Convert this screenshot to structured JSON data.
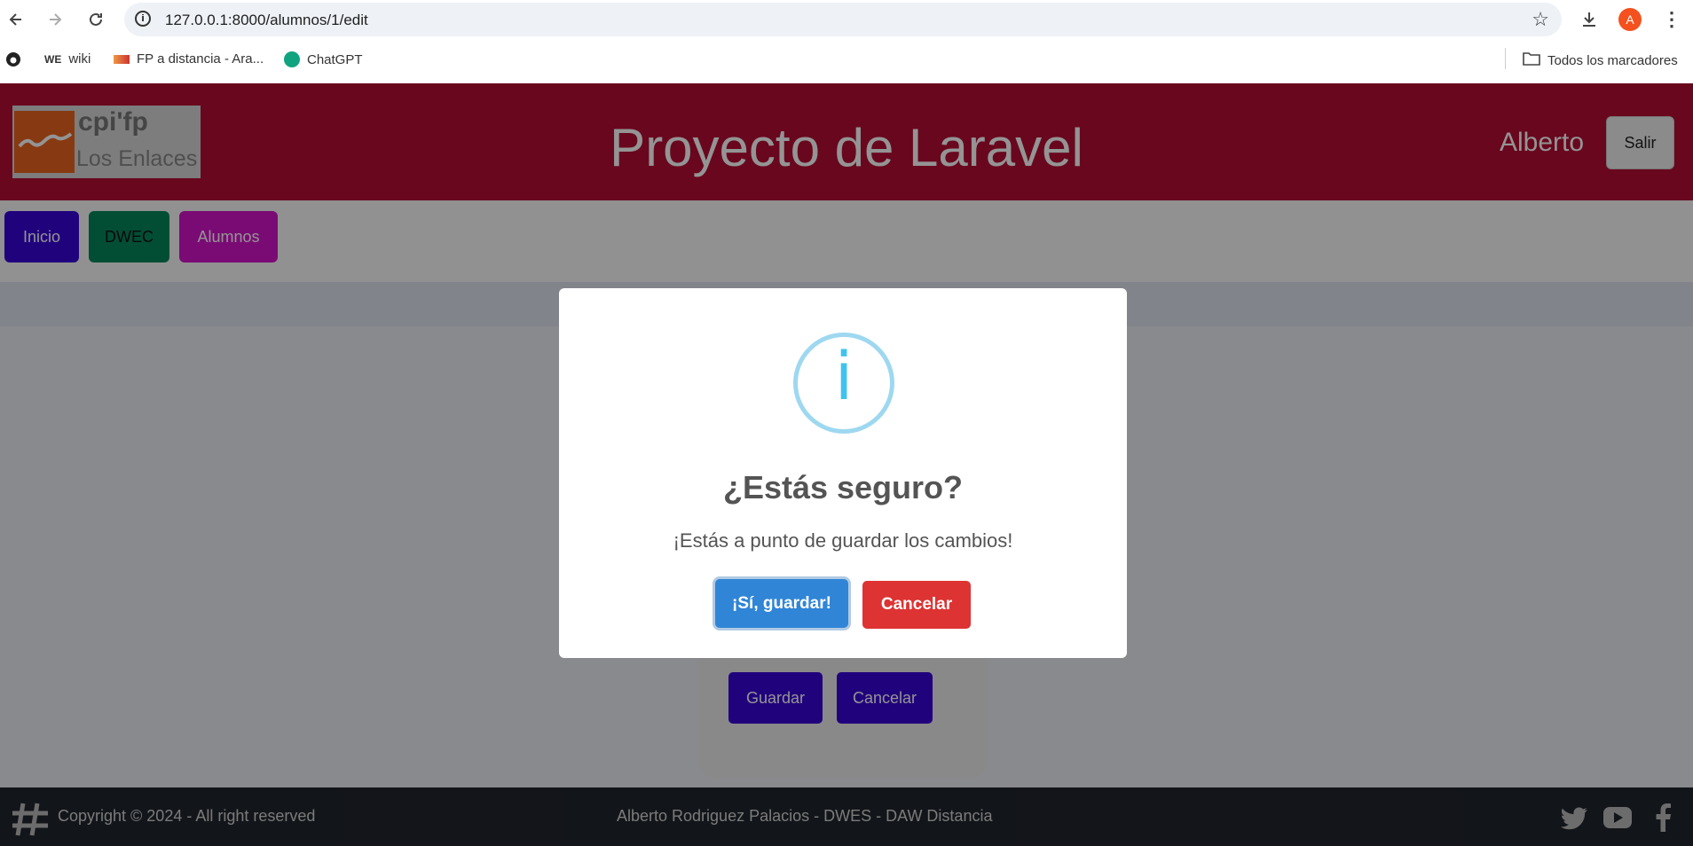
{
  "browser": {
    "url": "127.0.0.1:8000/alumnos/1/edit",
    "bookmarks": [
      {
        "label": "wiki",
        "icon": "we-icon"
      },
      {
        "label": "FP a distancia - Ara...",
        "icon": "fp-icon"
      },
      {
        "label": "ChatGPT",
        "icon": "chatgpt-icon"
      }
    ],
    "all_bookmarks": "Todos los marcadores",
    "profile_initial": "A"
  },
  "header": {
    "logo_text_top": "cpi'fp",
    "logo_text_bottom": "Los Enlaces",
    "title": "Proyecto de Laravel",
    "user": "Alberto",
    "logout": "Salir",
    "color": "#b50d35"
  },
  "nav": [
    {
      "label": "Inicio",
      "color": "#3a05d7"
    },
    {
      "label": "DWEC",
      "color": "#05875a"
    },
    {
      "label": "Alumnos",
      "color": "#d313c8"
    }
  ],
  "form": {
    "save_label": "Guardar",
    "cancel_label": "Cancelar"
  },
  "footer": {
    "copyright": "Copyright © 2024 - All right reserved",
    "author": "Alberto Rodriguez Palacios - DWES - DAW Distancia"
  },
  "modal": {
    "title": "¿Estás seguro?",
    "text": "¡Estás a punto de guardar los cambios!",
    "confirm": "¡Sí, guardar!",
    "cancel": "Cancelar",
    "icon": "i"
  }
}
